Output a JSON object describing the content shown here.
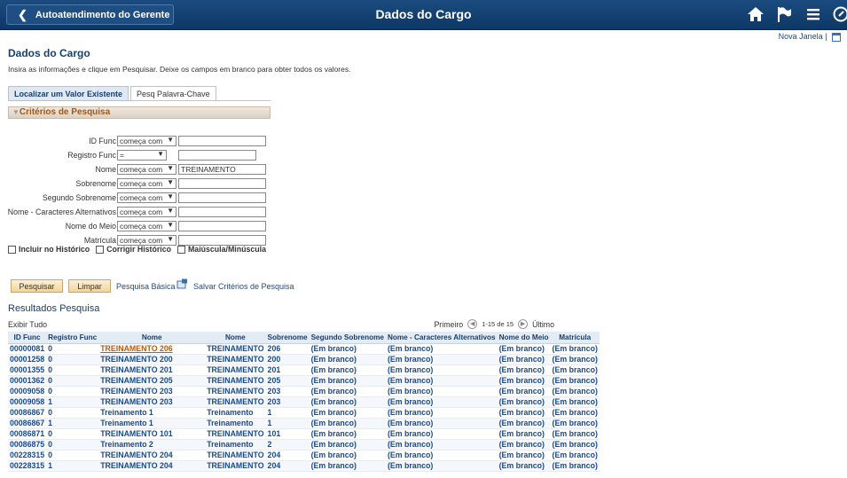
{
  "header": {
    "back_label": "Autoatendimento do Gerente",
    "title": "Dados do Cargo"
  },
  "nova_janela": "Nova Janela",
  "page_title": "Dados do Cargo",
  "instructions": "Insira as informações e clique em Pesquisar. Deixe os campos em branco para obter todos os valores.",
  "tabs": [
    "Localizar um Valor Existente",
    "Pesq Palavra-Chave"
  ],
  "criteria_title": "Critérios de Pesquisa",
  "fields": [
    {
      "label": "ID Func",
      "op": "começa com",
      "value": ""
    },
    {
      "label": "Registro Func",
      "op": "=",
      "value": ""
    },
    {
      "label": "Nome",
      "op": "começa com",
      "value": "TREINAMENTO"
    },
    {
      "label": "Sobrenome",
      "op": "começa com",
      "value": ""
    },
    {
      "label": "Segundo Sobrenome",
      "op": "começa com",
      "value": ""
    },
    {
      "label": "Nome - Caracteres Alternativos",
      "op": "começa com",
      "value": ""
    },
    {
      "label": "Nome do Meio",
      "op": "começa com",
      "value": ""
    },
    {
      "label": "Matrícula",
      "op": "começa com",
      "value": ""
    }
  ],
  "checkboxes": [
    "Incluir no Histórico",
    "Corrigir Histórico",
    "Maiúscula/Minúscula"
  ],
  "buttons": {
    "search": "Pesquisar",
    "clear": "Limpar",
    "basic_search": "Pesquisa Básica",
    "save_criteria": "Salvar Critérios de Pesquisa"
  },
  "results": {
    "title": "Resultados Pesquisa",
    "show_all": "Exibir Tudo",
    "first": "Primeiro",
    "range": "1-15 de 15",
    "last": "Último",
    "columns": [
      "ID Func",
      "Registro Func",
      "Nome",
      "Nome",
      "Sobrenome",
      "Segundo Sobrenome",
      "Nome - Caracteres Alternativos",
      "Nome do Meio",
      "Matrícula"
    ],
    "rows": [
      [
        "00000081",
        "0",
        "TREINAMENTO 206",
        "TREINAMENTO",
        "206",
        "(Em branco)",
        "(Em branco)",
        "(Em branco)",
        "(Em branco)"
      ],
      [
        "00001258",
        "0",
        "TREINAMENTO 200",
        "TREINAMENTO",
        "200",
        "(Em branco)",
        "(Em branco)",
        "(Em branco)",
        "(Em branco)"
      ],
      [
        "00001355",
        "0",
        "TREINAMENTO 201",
        "TREINAMENTO",
        "201",
        "(Em branco)",
        "(Em branco)",
        "(Em branco)",
        "(Em branco)"
      ],
      [
        "00001362",
        "0",
        "TREINAMENTO 205",
        "TREINAMENTO",
        "205",
        "(Em branco)",
        "(Em branco)",
        "(Em branco)",
        "(Em branco)"
      ],
      [
        "00009058",
        "0",
        "TREINAMENTO 203",
        "TREINAMENTO",
        "203",
        "(Em branco)",
        "(Em branco)",
        "(Em branco)",
        "(Em branco)"
      ],
      [
        "00009058",
        "1",
        "TREINAMENTO 203",
        "TREINAMENTO",
        "203",
        "(Em branco)",
        "(Em branco)",
        "(Em branco)",
        "(Em branco)"
      ],
      [
        "00086867",
        "0",
        "Treinamento 1",
        "Treinamento",
        "1",
        "(Em branco)",
        "(Em branco)",
        "(Em branco)",
        "(Em branco)"
      ],
      [
        "00086867",
        "1",
        "Treinamento 1",
        "Treinamento",
        "1",
        "(Em branco)",
        "(Em branco)",
        "(Em branco)",
        "(Em branco)"
      ],
      [
        "00086871",
        "0",
        "TREINAMENTO 101",
        "TREINAMENTO",
        "101",
        "(Em branco)",
        "(Em branco)",
        "(Em branco)",
        "(Em branco)"
      ],
      [
        "00086875",
        "0",
        "Treinamento 2",
        "Treinamento",
        "2",
        "(Em branco)",
        "(Em branco)",
        "(Em branco)",
        "(Em branco)"
      ],
      [
        "00228315",
        "0",
        "TREINAMENTO 204",
        "TREINAMENTO",
        "204",
        "(Em branco)",
        "(Em branco)",
        "(Em branco)",
        "(Em branco)"
      ],
      [
        "00228315",
        "1",
        "TREINAMENTO 204",
        "TREINAMENTO",
        "204",
        "(Em branco)",
        "(Em branco)",
        "(Em branco)",
        "(Em branco)"
      ]
    ]
  }
}
